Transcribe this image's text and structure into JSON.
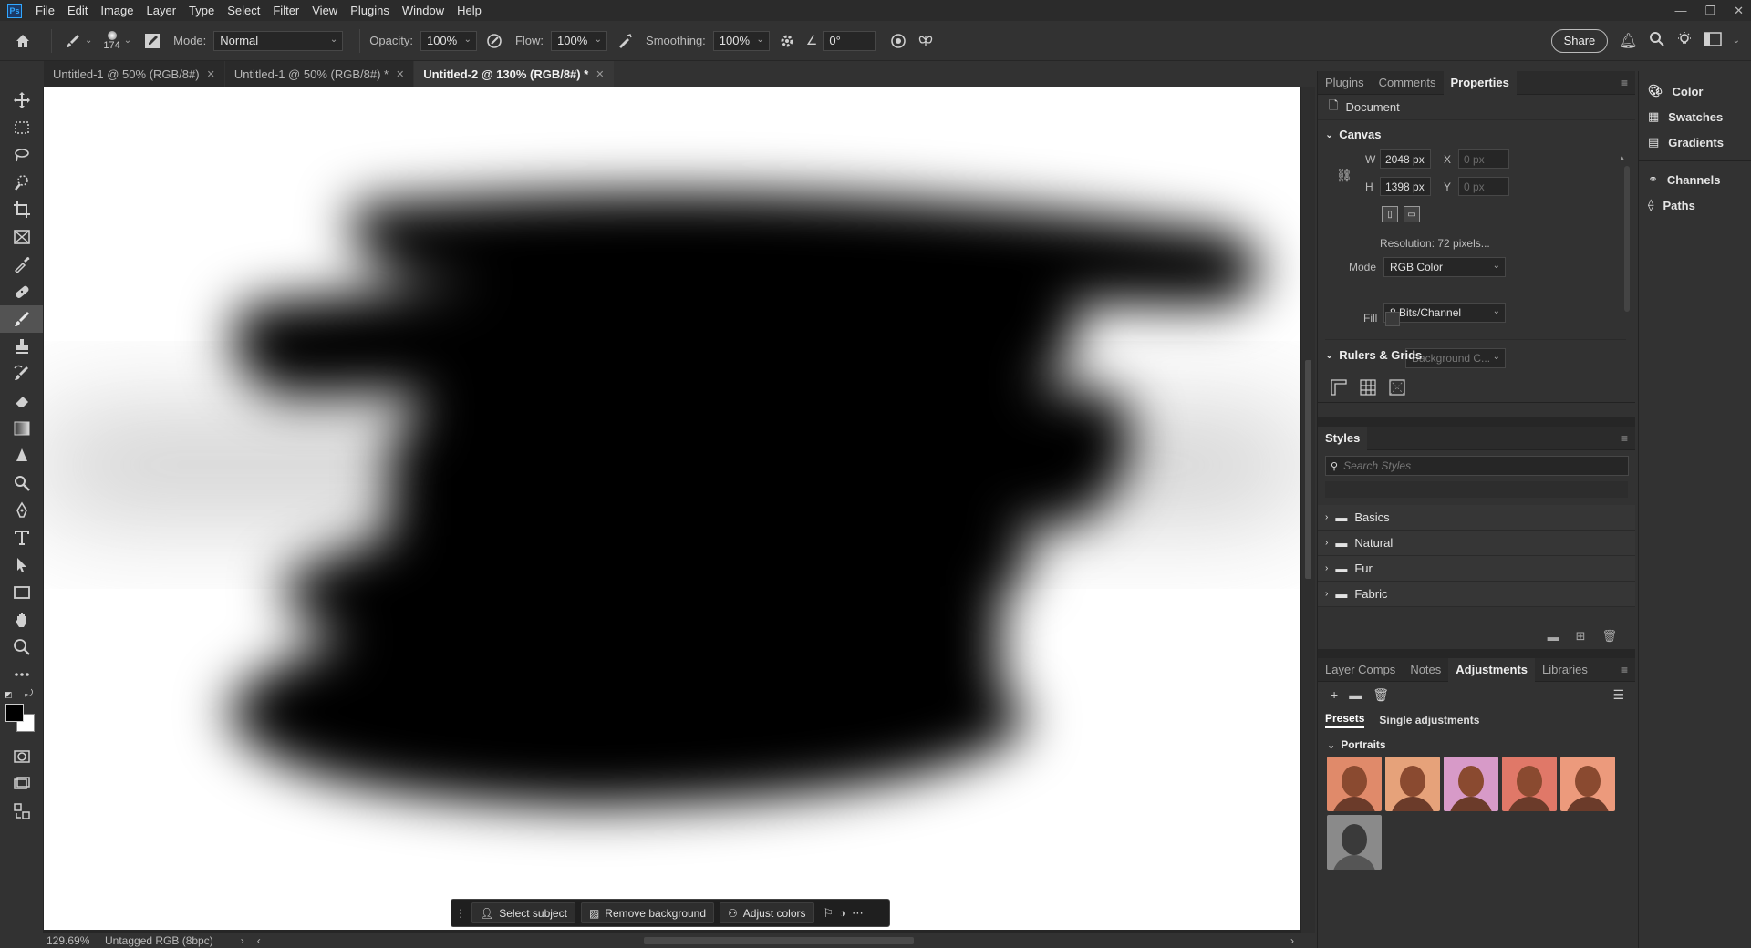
{
  "app": {
    "logo": "Ps"
  },
  "menu": [
    "File",
    "Edit",
    "Image",
    "Layer",
    "Type",
    "Select",
    "Filter",
    "View",
    "Plugins",
    "Window",
    "Help"
  ],
  "options": {
    "brush_size": "174",
    "mode_label": "Mode:",
    "mode_value": "Normal",
    "opacity_label": "Opacity:",
    "opacity_value": "100%",
    "flow_label": "Flow:",
    "flow_value": "100%",
    "smoothing_label": "Smoothing:",
    "smoothing_value": "100%",
    "angle_value": "0°",
    "share_label": "Share"
  },
  "tabs": [
    {
      "label": "Untitled-1 @ 50% (RGB/8#)",
      "active": false
    },
    {
      "label": "Untitled-1 @ 50% (RGB/8#) *",
      "active": false
    },
    {
      "label": "Untitled-2 @ 130% (RGB/8#) *",
      "active": true
    }
  ],
  "status": {
    "zoom": "129.69%",
    "profile": "Untagged RGB (8bpc)"
  },
  "contextual": {
    "select_subject": "Select subject",
    "remove_bg": "Remove background",
    "adjust_colors": "Adjust colors"
  },
  "properties": {
    "tabs": [
      "Plugins",
      "Comments",
      "Properties"
    ],
    "doc_label": "Document",
    "canvas_title": "Canvas",
    "w_label": "W",
    "w_value": "2048 px",
    "h_label": "H",
    "h_value": "1398 px",
    "x_label": "X",
    "x_value": "0 px",
    "y_label": "Y",
    "y_value": "0 px",
    "resolution": "Resolution: 72 pixels...",
    "mode_label": "Mode",
    "mode_value": "RGB Color",
    "bits_value": "8 Bits/Channel",
    "fill_label": "Fill",
    "fill_value": "Background C...",
    "rulers_title": "Rulers & Grids"
  },
  "styles": {
    "title": "Styles",
    "search_placeholder": "Search Styles",
    "folders": [
      "Basics",
      "Natural",
      "Fur",
      "Fabric"
    ]
  },
  "adjustments": {
    "tabs": [
      "Layer Comps",
      "Notes",
      "Adjustments",
      "Libraries"
    ],
    "subtabs": [
      "Presets",
      "Single adjustments"
    ],
    "section": "Portraits",
    "thumb_colors": [
      "#e08a6a",
      "#e6a27a",
      "#d79ac8",
      "#e07868",
      "#ec9a7c",
      "#8a8a8a"
    ]
  },
  "dock": [
    "Color",
    "Swatches",
    "Gradients",
    "Channels",
    "Paths"
  ]
}
